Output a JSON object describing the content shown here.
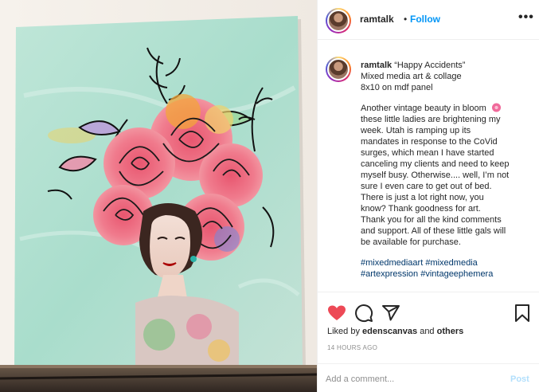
{
  "post": {
    "image_alt": "Mixed media painting of a woman with a headdress of pink roses on a mint green panel",
    "username": "ramtalk",
    "follow_separator": "•",
    "follow_label": "Follow",
    "more_label": "•••"
  },
  "caption": {
    "username": "ramtalk",
    "lines": [
      "“Happy Accidents”",
      "Mixed media art & collage",
      "8x10 on mdf panel"
    ],
    "body_lines": [
      "Another vintage beauty in bloom",
      "these little ladies are brightening my",
      "week. Utah is ramping up its",
      "mandates in response to the CoVid",
      "surges, which mean I have started",
      "canceling my clients and need to keep",
      "myself busy. Otherwise.... well, I’m not",
      "sure I even care to get out of bed.",
      "There is just a lot right now, you",
      "know? Thank goodness for art.",
      "Thank you for all the kind comments",
      "and support. All of these little gals will",
      "be available for purchase."
    ],
    "hashtags_line1": [
      "#mixedmediaart",
      "#mixedmedia"
    ],
    "hashtags_line2": [
      "#artexpression",
      "#vintageephemera"
    ]
  },
  "actions": {
    "liked_by_prefix": "Liked by ",
    "liked_by_user": "edenscanvas",
    "liked_by_and": " and ",
    "liked_by_others": "others",
    "timestamp": "14 HOURS AGO",
    "comment_placeholder": "Add a comment...",
    "post_label": "Post"
  },
  "icons": {
    "like": "heart-icon",
    "comment": "comment-icon",
    "share": "share-icon",
    "save": "bookmark-icon"
  },
  "colors": {
    "accent": "#0095f6",
    "like_red": "#ed4956",
    "text": "#262626",
    "muted": "#8e8e8e",
    "hashtag": "#00376b",
    "post_disabled": "#b2dffc"
  }
}
